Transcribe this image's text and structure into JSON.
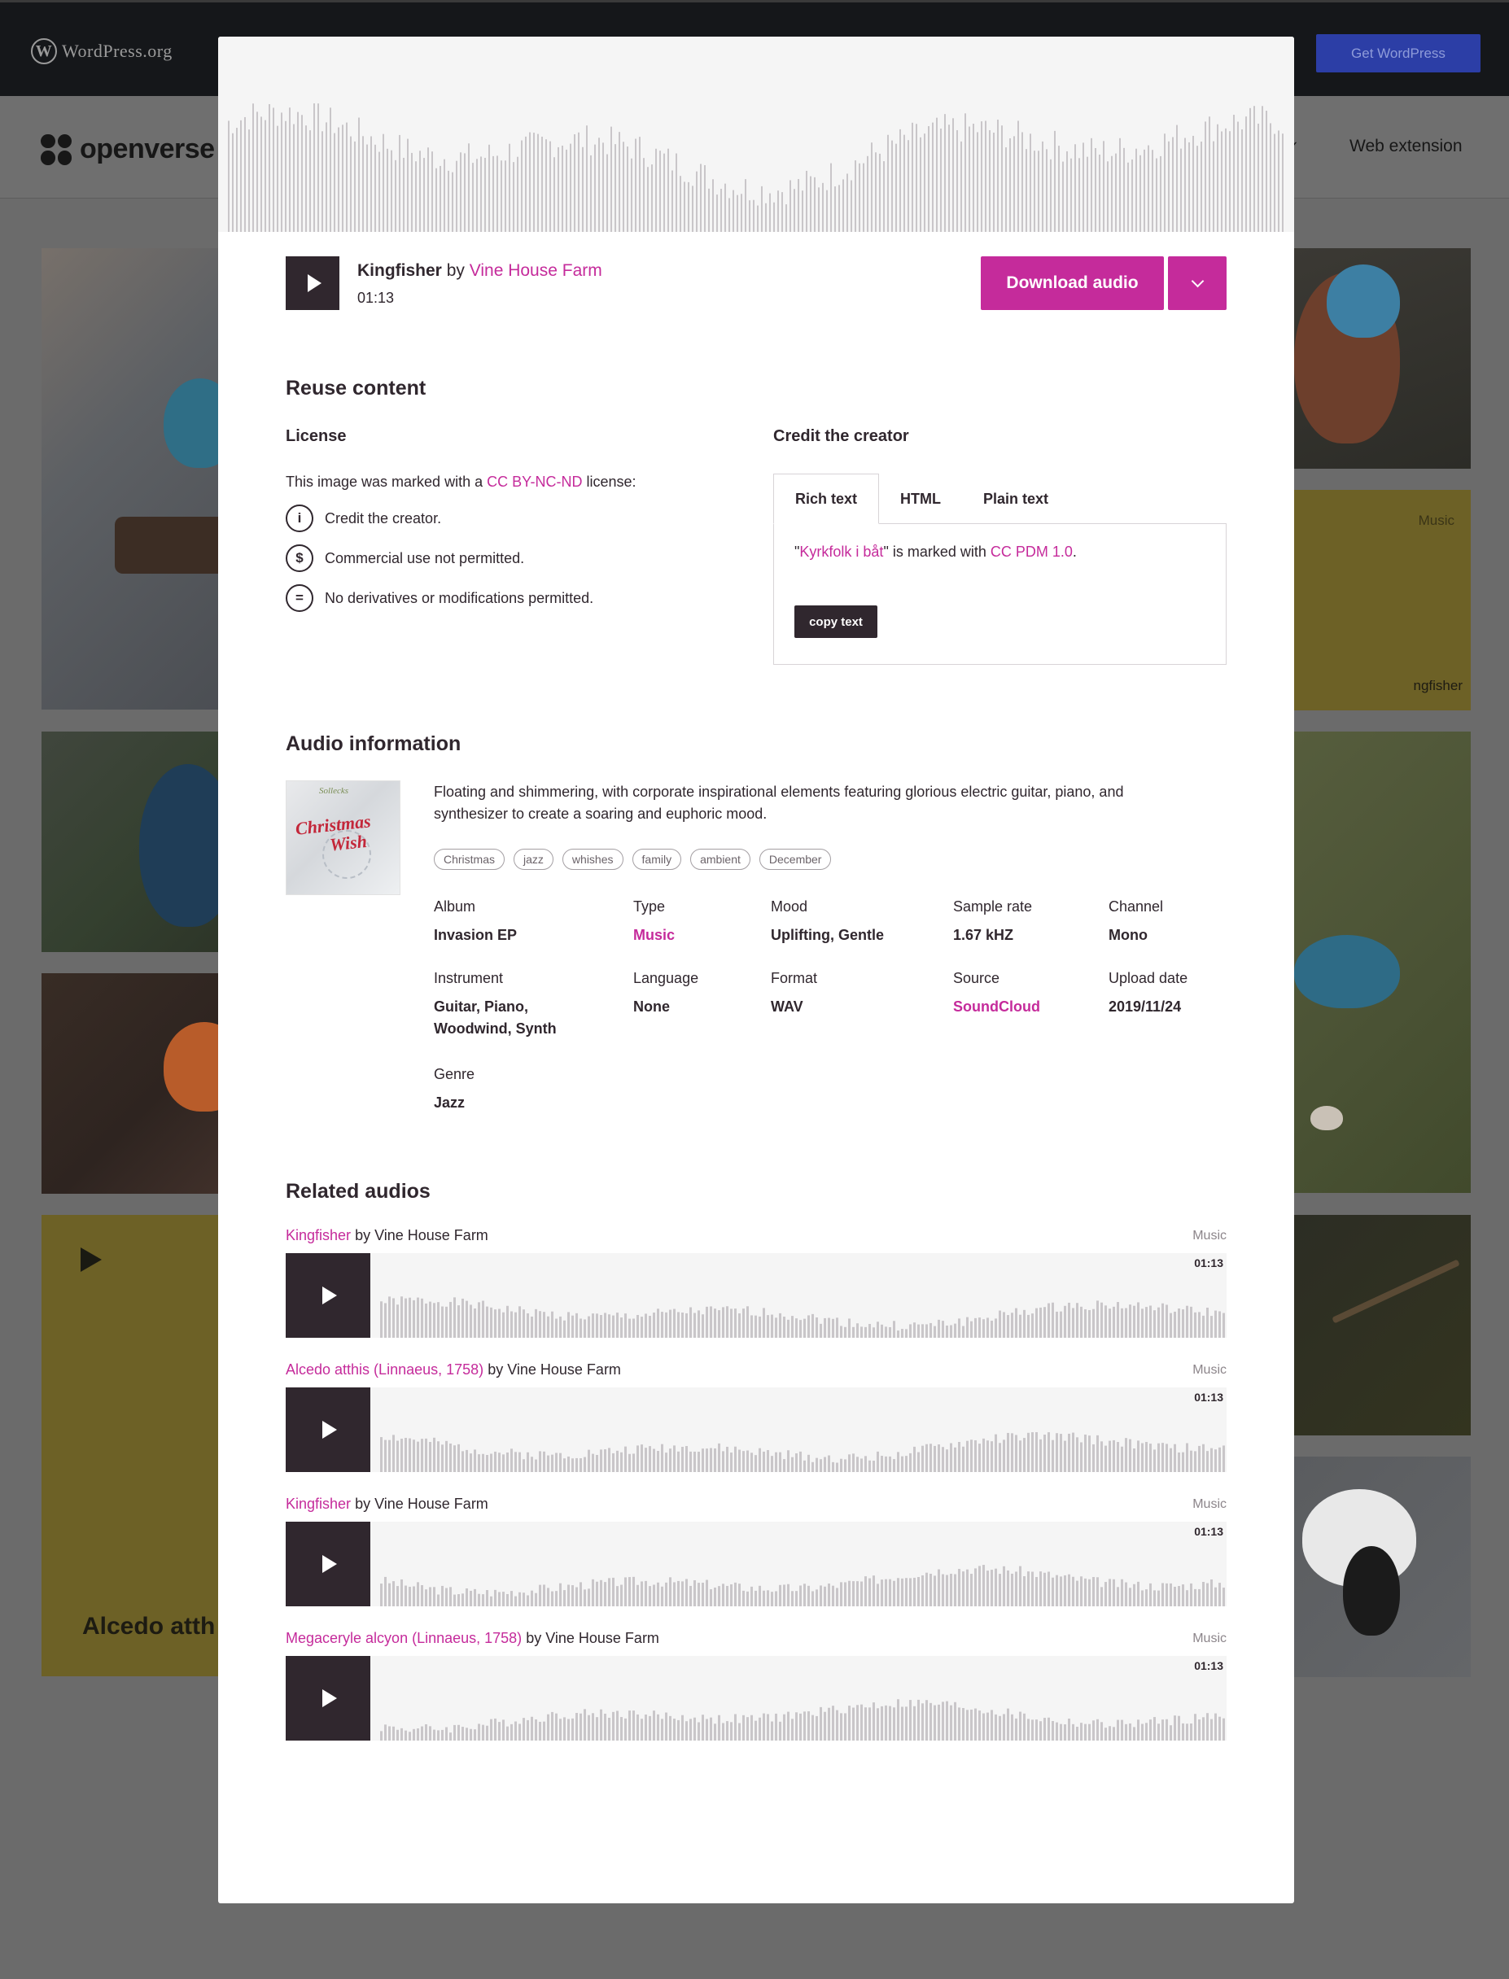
{
  "background": {
    "wp_logo": "WordPress.org",
    "get_wordpress": "Get WordPress",
    "site_name": "openverse",
    "web_extension": "Web extension",
    "tiles": [
      {
        "type_label": "Music",
        "caption": "ngfisher"
      },
      {
        "title": "Alcedo atth"
      }
    ]
  },
  "player": {
    "title": "Kingfisher",
    "by": "by",
    "creator": "Vine House Farm",
    "duration": "01:13",
    "download_label": "Download audio"
  },
  "reuse": {
    "heading": "Reuse content",
    "license_heading": "License",
    "license_prefix": "This image was marked with a",
    "license_name": "CC BY-NC-ND",
    "license_suffix": "license:",
    "items": [
      {
        "icon": "by-icon",
        "glyph": "i",
        "text": "Credit the creator."
      },
      {
        "icon": "nc-icon",
        "glyph": "$",
        "text": "Commercial use not permitted."
      },
      {
        "icon": "nd-icon",
        "glyph": "=",
        "text": "No derivatives or modifications permitted."
      }
    ],
    "credit_heading": "Credit the creator",
    "tabs": [
      "Rich text",
      "HTML",
      "Plain text"
    ],
    "credit_quote_open": "\"",
    "credit_work": "Kyrkfolk i båt",
    "credit_mid": "\" is marked with ",
    "credit_license": "CC PDM 1.0",
    "credit_end": ".",
    "copy_label": "copy text"
  },
  "info": {
    "heading": "Audio information",
    "cover": {
      "small": "Sollecks",
      "title_line1": "Christmas",
      "title_line2": "Wish"
    },
    "description": "Floating and shimmering, with corporate inspirational elements featuring glorious electric guitar, piano, and synthesizer to create a soaring and euphoric mood.",
    "tags": [
      "Christmas",
      "jazz",
      "whishes",
      "family",
      "ambient",
      "December"
    ],
    "meta": {
      "album": {
        "k": "Album",
        "v": "Invasion EP"
      },
      "type": {
        "k": "Type",
        "v": "Music"
      },
      "mood": {
        "k": "Mood",
        "v": "Uplifting, Gentle"
      },
      "sample_rate": {
        "k": "Sample rate",
        "v": "1.67 kHZ"
      },
      "channel": {
        "k": "Channel",
        "v": "Mono"
      },
      "instrument": {
        "k": "Instrument",
        "v1": "Guitar, Piano,",
        "v2": "Woodwind, Synth"
      },
      "language": {
        "k": "Language",
        "v": "None"
      },
      "format": {
        "k": "Format",
        "v": "WAV"
      },
      "source": {
        "k": "Source",
        "v": "SoundCloud"
      },
      "upload_date": {
        "k": "Upload date",
        "v": "2019/11/24"
      },
      "genre": {
        "k": "Genre",
        "v": "Jazz"
      }
    }
  },
  "related": {
    "heading": "Related audios",
    "items": [
      {
        "title": "Kingfisher",
        "by": "by Vine House Farm",
        "type": "Music",
        "duration": "01:13"
      },
      {
        "title": "Alcedo atthis (Linnaeus, 1758)",
        "by": "by Vine House Farm",
        "type": "Music",
        "duration": "01:13"
      },
      {
        "title": "Kingfisher",
        "by": "by Vine House Farm",
        "type": "Music",
        "duration": "01:13"
      },
      {
        "title": "Megaceryle alcyon (Linnaeus, 1758)",
        "by": "by Vine House Farm",
        "type": "Music",
        "duration": "01:13"
      }
    ]
  },
  "colors": {
    "accent": "#c52b9b",
    "dark": "#30272e",
    "wave": "#c9c6c9"
  }
}
